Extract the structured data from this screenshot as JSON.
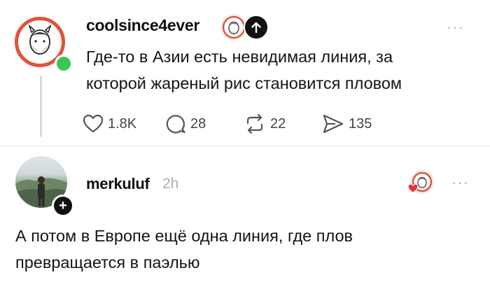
{
  "post": {
    "username": "coolsince4ever",
    "text_line1": "Где-то в Азии есть невидимая линия, за",
    "text_line2": "которой жареный рис становится пловом",
    "more_label": "···",
    "likes": "1.8K",
    "comments": "28",
    "reposts": "22",
    "shares": "135"
  },
  "reply": {
    "username": "merkuluf",
    "time": "2h",
    "more_label": "···",
    "follow_symbol": "+",
    "text_line1": "А потом в Европе ещё одна линия, где плов",
    "text_line2": "превращается в паэлью"
  },
  "colors": {
    "avatar_ring": "#e0533d",
    "online": "#3ec45a",
    "heart": "#e8333a"
  },
  "icons": [
    "heart-icon",
    "comment-icon",
    "repost-icon",
    "share-icon",
    "more-icon",
    "arrow-up-icon",
    "plus-icon"
  ]
}
